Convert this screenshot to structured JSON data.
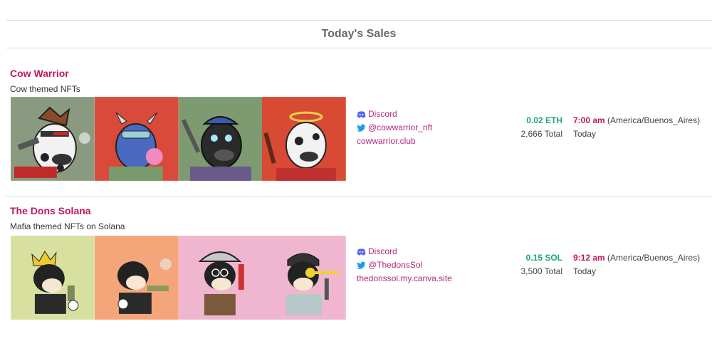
{
  "header": {
    "title": "Today's Sales"
  },
  "sales": [
    {
      "name": "Cow Warrior",
      "description": "Cow themed NFTs",
      "discord_label": "Discord",
      "twitter_label": "@cowwarrior_nft",
      "website_label": "cowwarrior.club",
      "price": "0.02 ETH",
      "total": "2,666 Total",
      "time": "7:00 am",
      "timezone": "(America/Buenos_Aires)",
      "day": "Today",
      "thumbs": [
        "#8a9a80",
        "#d94a3a",
        "#7d9a70",
        "#d94a34"
      ]
    },
    {
      "name": "The Dons Solana",
      "description": "Mafia themed NFTs on Solana",
      "discord_label": "Discord",
      "twitter_label": "@ThedonsSol",
      "website_label": "thedonssol.my.canva.site",
      "price": "0.15 SOL",
      "total": "3,500 Total",
      "time": "9:12 am",
      "timezone": "(America/Buenos_Aires)",
      "day": "Today",
      "thumbs": [
        "#d8e0a0",
        "#f5a57a",
        "#f0b6cf",
        "#f0b6cf"
      ]
    }
  ],
  "colors": {
    "accent": "#c0185f",
    "link": "#b2297c",
    "price": "#19a86c",
    "divider": "#e6dde2"
  }
}
